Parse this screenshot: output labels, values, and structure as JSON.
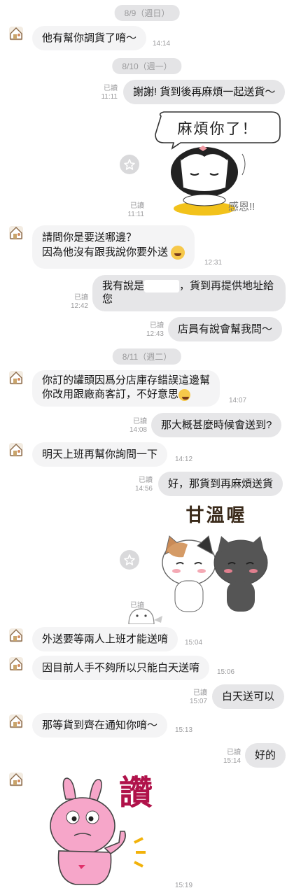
{
  "icons": {
    "avatar": "house-avatar-icon",
    "sticker_button": "star-icon"
  },
  "colors": {
    "bubble_in": "#f4f4f5",
    "bubble_out": "#e6e6e8",
    "date_pill": "#e4e4e6",
    "meta": "#9c9c9e"
  },
  "dates": [
    "8/9（週日）",
    "8/10（週一）",
    "8/11（週二）"
  ],
  "read_label": "已讀",
  "messages": [
    {
      "text": "他有幫你調貨了唷～",
      "time": "14:14"
    },
    {
      "text": "謝謝! 貨到後再麻煩一起送貨～",
      "time": "11:11"
    },
    {
      "sticker_text": "麻煩你了！",
      "sticker_sub": "感恩!!",
      "time": "11:11"
    },
    {
      "line1": "請問你是要送哪邊？",
      "line2": "因為他沒有跟我說你要外送",
      "time": "12:31"
    },
    {
      "line1a": "我有說是",
      "line1b": "，貨到再提供地址給",
      "line2": "您",
      "time": "12:42"
    },
    {
      "text": "店員有說會幫我問～",
      "time": "12:43"
    },
    {
      "line1": "你訂的罐頭因爲分店庫存錯誤這邊幫",
      "line2": "你改用跟廠商客訂，不好意思",
      "time": "14:07"
    },
    {
      "text": "那大概甚麼時候會送到?",
      "time": "14:08"
    },
    {
      "text": "明天上班再幫你詢問一下",
      "time": "14:12"
    },
    {
      "text": "好，那貨到再麻煩送貨",
      "time": "14:56"
    },
    {
      "sticker_text": "甘溫喔",
      "time": ""
    },
    {
      "text": "外送要等兩人上班才能送唷",
      "time": "15:04"
    },
    {
      "text": "因目前人手不夠所以只能白天送唷",
      "time": "15:06"
    },
    {
      "text": "白天送可以",
      "time": "15:07"
    },
    {
      "text": "那等貨到齊在通知你唷～",
      "time": "15:13"
    },
    {
      "text": "好的",
      "time": "15:14"
    },
    {
      "sticker_text": "讚",
      "time": "15:19"
    }
  ]
}
